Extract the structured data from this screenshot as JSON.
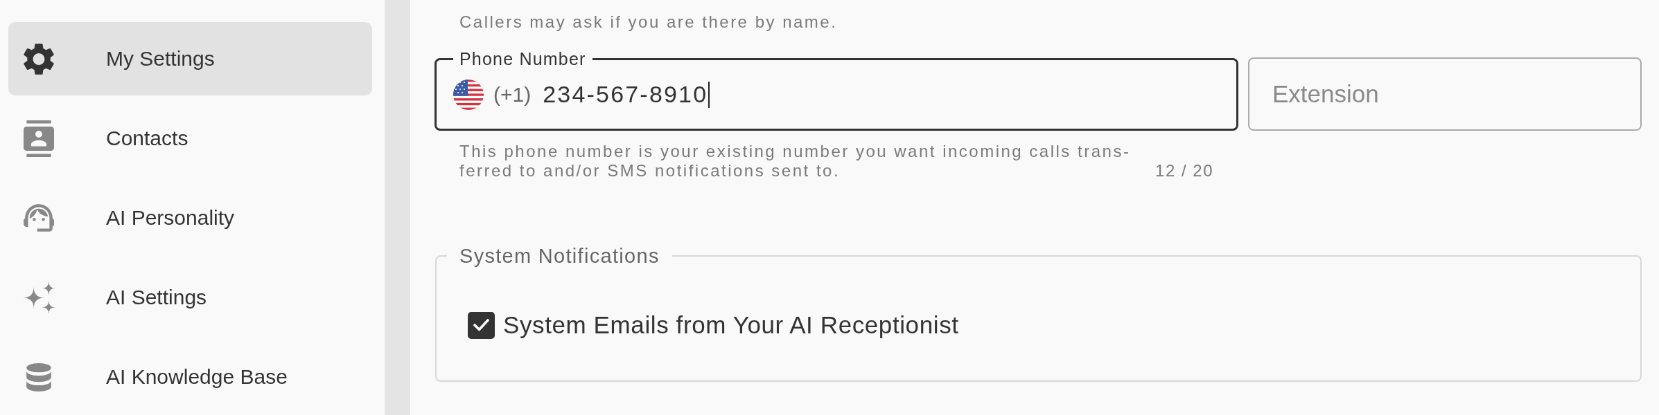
{
  "sidebar": {
    "items": [
      {
        "label": "My Settings",
        "selected": true
      },
      {
        "label": "Contacts",
        "selected": false
      },
      {
        "label": "AI Personality",
        "selected": false
      },
      {
        "label": "AI Settings",
        "selected": false
      },
      {
        "label": "AI Knowledge Base",
        "selected": false
      }
    ]
  },
  "main": {
    "hint": "Callers may ask if you are there by name.",
    "phone_field": {
      "label": "Phone Number",
      "country_code": "(+1)",
      "value": "234-567-8910",
      "focused": true,
      "helper": "This phone number is your existing number you want incoming calls trans-ferred to and/or SMS notifications sent to.",
      "counter": "12 / 20"
    },
    "extension_field": {
      "placeholder": "Extension"
    },
    "system_notifications": {
      "title": "System Notifications",
      "options": [
        {
          "label": "System Emails from Your AI Receptionist",
          "checked": true
        }
      ]
    }
  }
}
